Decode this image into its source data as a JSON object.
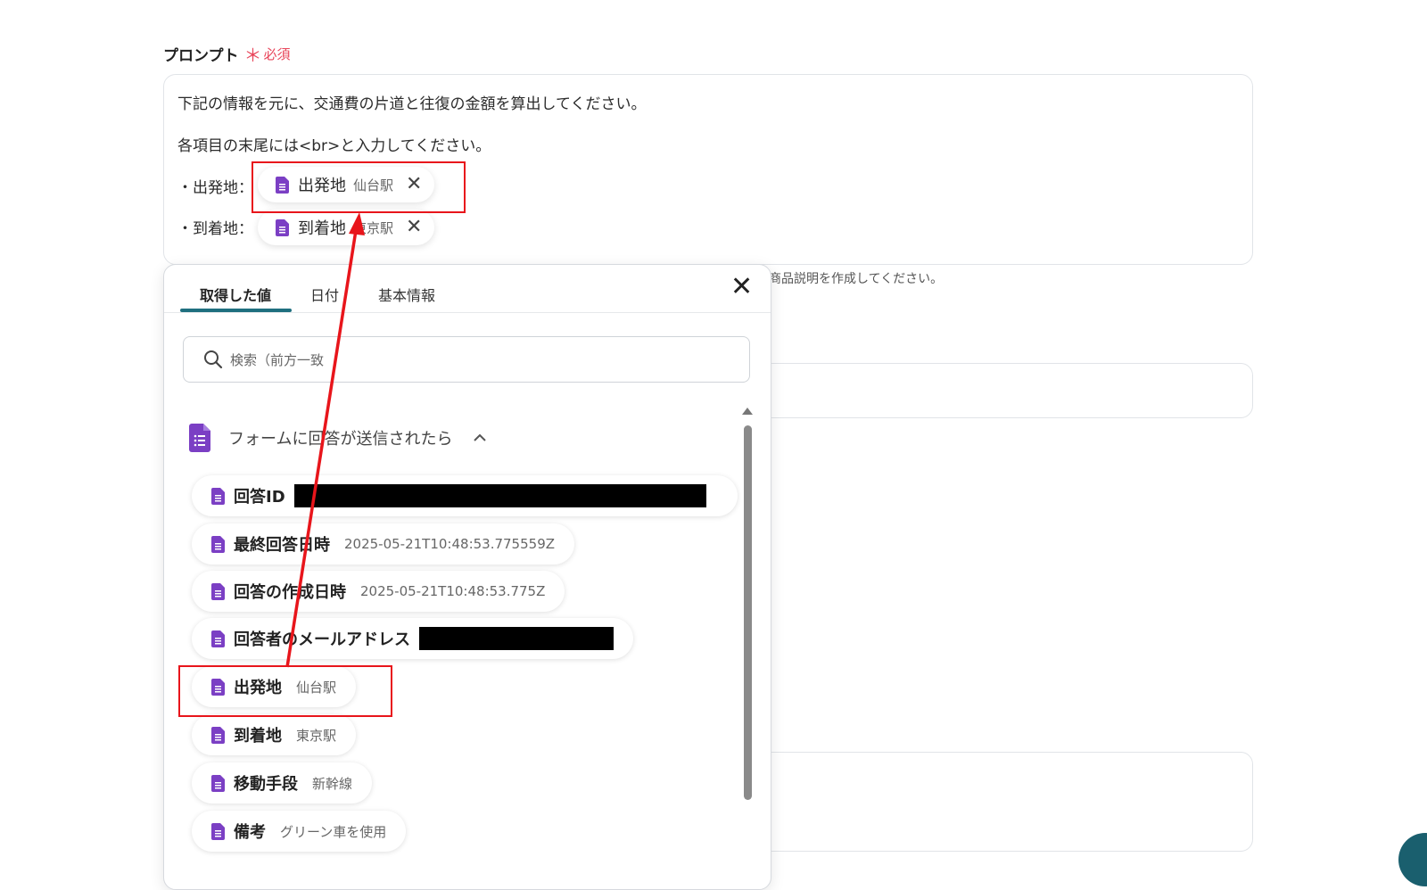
{
  "field": {
    "label": "プロンプト",
    "required_star": "＊",
    "required_text": "必須"
  },
  "prompt": {
    "line1": "下記の情報を元に、交通費の片道と往復の金額を算出してください。",
    "line2": "各項目の末尾には<br>と入力してください。",
    "row1_prefix": "・出発地：",
    "row2_prefix": "・到着地：",
    "chip1": {
      "label": "出発地",
      "value": "仙台駅",
      "close": "✕"
    },
    "chip2": {
      "label": "到着地",
      "value": "東京駅",
      "close": "✕"
    }
  },
  "hint_text": "商品説明を作成してください。",
  "popup": {
    "tabs": [
      "取得した値",
      "日付",
      "基本情報"
    ],
    "close": "✕",
    "search_placeholder": "検索（前方一致）",
    "search_placeholder_visible": "検索（前方一致",
    "group_title": "フォームに回答が送信されたら",
    "group_chevron": "^",
    "items": [
      {
        "label": "回答ID",
        "value": "",
        "redacted": true
      },
      {
        "label": "最終回答日時",
        "value": "2025-05-21T10:48:53.775559Z"
      },
      {
        "label": "回答の作成日時",
        "value": "2025-05-21T10:48:53.775Z"
      },
      {
        "label": "回答者のメールアドレス",
        "value": "",
        "redacted": true
      },
      {
        "label": "出発地",
        "value": "仙台駅"
      },
      {
        "label": "到着地",
        "value": "東京駅"
      },
      {
        "label": "移動手段",
        "value": "新幹線"
      },
      {
        "label": "備考",
        "value": "グリーン車を使用"
      }
    ]
  },
  "colors": {
    "accent": "#1f6f7f",
    "required": "#e8455a",
    "highlight": "#e8151b",
    "doc_icon": "#7b3fc4"
  }
}
